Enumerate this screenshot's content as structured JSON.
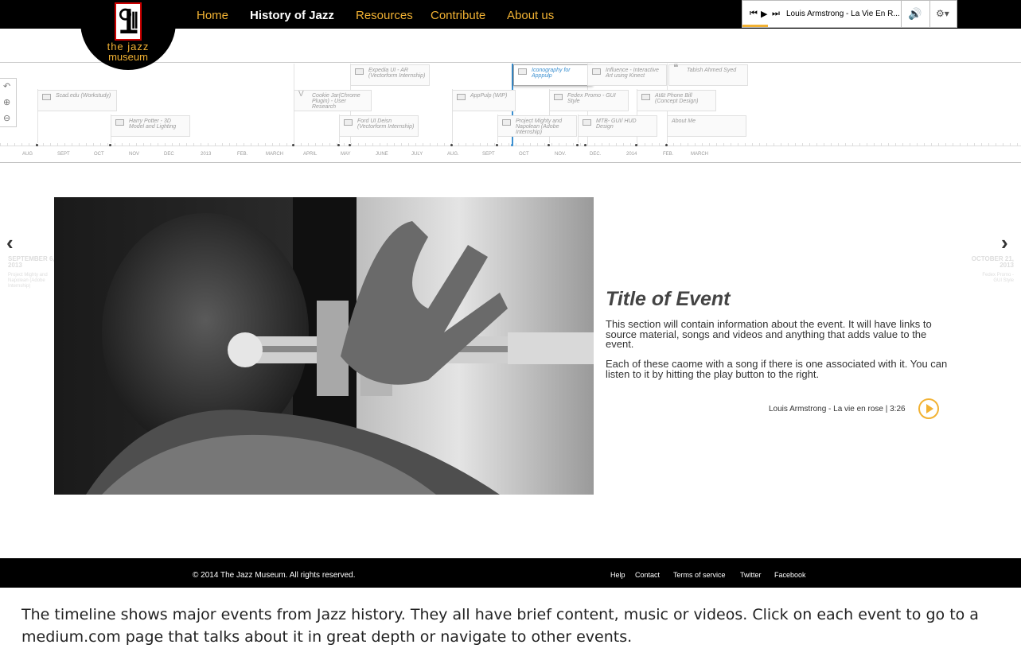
{
  "header": {
    "logo_line1": "the jazz",
    "logo_line2": "museum",
    "nav": [
      {
        "label": "Home"
      },
      {
        "label": "History of Jazz"
      },
      {
        "label": "Resources"
      },
      {
        "label": "Contribute"
      },
      {
        "label": "About us"
      }
    ],
    "active_nav": "History of Jazz"
  },
  "player": {
    "track": "Louis Armstrong - La Vie En R...",
    "progress": 0.12
  },
  "timeline": {
    "events": [
      {
        "title": "Expedia UI - AR (Vectorform Internship)"
      },
      {
        "title": "Iconography for Apppulp"
      },
      {
        "title": "Influence - Interactive Art using Kinect"
      },
      {
        "title": "Tabish Ahmed Syed"
      },
      {
        "title": "Scad.edu (Workstudy)"
      },
      {
        "title": "Cookie Jar(Chrome Plugin) - User Research"
      },
      {
        "title": "AppPulp (WIP)"
      },
      {
        "title": "Fedex Promo - GUI Style"
      },
      {
        "title": "At&t Phone Bill (Concept Design)"
      },
      {
        "title": "Harry Potter - 3D Model and Lighting"
      },
      {
        "title": "Ford UI Deisn (Vectorform Internship)"
      },
      {
        "title": "Project Mighty and Napolean (Adobe Internship)"
      },
      {
        "title": "MTB- GUI/ HUD Design"
      },
      {
        "title": "About Me"
      }
    ],
    "months": [
      "AUG",
      "SEPT",
      "OCT",
      "NOV",
      "DEC",
      "2013",
      "FEB.",
      "MARCH",
      "APRIL",
      "MAY",
      "JUNE",
      "JULY",
      "AUG.",
      "SEPT",
      "OCT",
      "NOV.",
      "DEC.",
      "2014",
      "FEB.",
      "MARCH"
    ]
  },
  "event": {
    "title": "Title of Event",
    "para1": "This section will contain information about the event. It will have links to source material, songs and videos and anything that adds value to the event.",
    "para2": "Each of these caome with a song if there is one associated with it. You can listen to it by hitting the play button to the right.",
    "song": "Louis Armstrong - La vie en rose | 3:26"
  },
  "nav_prev": {
    "arrow": "‹",
    "date": "SEPTEMBER 6, 2013",
    "desc": "Project Mighty and Napolean (Adobe Internship)"
  },
  "nav_next": {
    "arrow": "›",
    "date": "OCTOBER 21, 2013",
    "desc": "Fedex Promo - GUI Style"
  },
  "footer": {
    "copyright": "© 2014 The Jazz Museum. All rights reserved.",
    "links": [
      "Help",
      "Contact",
      "Terms of service",
      "Twitter",
      "Facebook"
    ]
  },
  "caption": "The timeline shows major events from Jazz history. They all have brief content, music or videos. Click on each event to go to a medium.com page that talks about it in great depth or navigate to other events.",
  "colors": {
    "accent": "#f2b233",
    "timeline_active": "#3a8fd0"
  }
}
